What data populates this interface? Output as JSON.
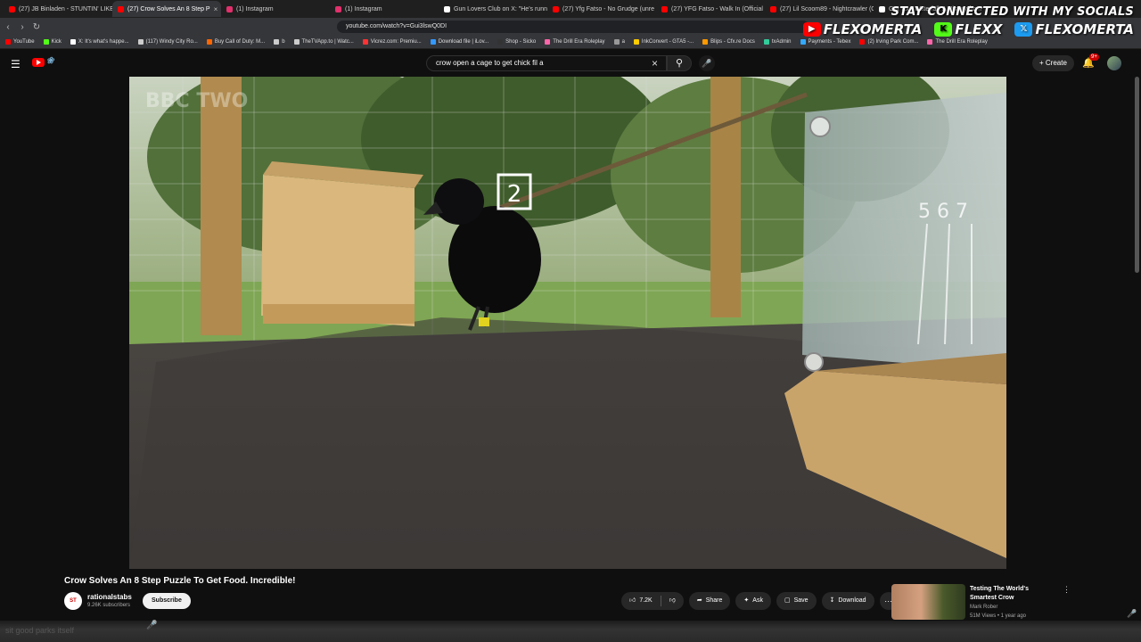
{
  "browser": {
    "tabs": [
      {
        "label": "(27) JB Binladen - STUNTIN' LIKE MY",
        "color": "#ff0000",
        "active": false
      },
      {
        "label": "(27) Crow Solves An 8 Step P",
        "color": "#ff0000",
        "active": true
      },
      {
        "label": "(1) Instagram",
        "color": "#e1306c",
        "active": false
      },
      {
        "label": "(1) Instagram",
        "color": "#e1306c",
        "active": false
      },
      {
        "label": "Gun Lovers Club on X: \"He's running",
        "color": "#ffffff",
        "active": false
      },
      {
        "label": "(27) Yfg Fatso - No Grudge (unre",
        "color": "#ff0000",
        "active": false
      },
      {
        "label": "(27) YFG Fatso - Walk In (Official Mu",
        "color": "#ff0000",
        "active": false
      },
      {
        "label": "(27) Lil Scoom89 - Nightcrawler (Offi",
        "color": "#ff0000",
        "active": false
      },
      {
        "label": "Get Your Waterfall: A History from",
        "color": "#ffffff",
        "active": false
      }
    ],
    "url": "youtube.com/watch?v=Gui3lswQ0DI",
    "bookmarks": [
      {
        "label": "YouTube",
        "color": "#ff0000"
      },
      {
        "label": "Kick",
        "color": "#53fc18"
      },
      {
        "label": "X: It's what's happe...",
        "color": "#ffffff"
      },
      {
        "label": "(117) Windy City Ro...",
        "color": "#cccccc"
      },
      {
        "label": "Buy Call of Duty: M...",
        "color": "#ff6600"
      },
      {
        "label": "b",
        "color": "#cccccc"
      },
      {
        "label": "TheTVApp.to | Watc...",
        "color": "#cccccc"
      },
      {
        "label": "Vicrez.com: Premiu...",
        "color": "#ff3333"
      },
      {
        "label": "Download file | iLov...",
        "color": "#3399ff"
      },
      {
        "label": "Shop - Sicko",
        "color": "#333333"
      },
      {
        "label": "The Drill Era Roleplay",
        "color": "#ff66aa"
      },
      {
        "label": "a",
        "color": "#999999"
      },
      {
        "label": "InkConvert - GTA5 -...",
        "color": "#ffcc00"
      },
      {
        "label": "Blips - Cfx.re Docs",
        "color": "#ff9900"
      },
      {
        "label": "txAdmin",
        "color": "#33cc99"
      },
      {
        "label": "Payments - Tebex",
        "color": "#33aaff"
      },
      {
        "label": "(2) Irving Park Com...",
        "color": "#ff0000"
      },
      {
        "label": "The Drill Era Roleplay",
        "color": "#ff66aa"
      }
    ]
  },
  "overlay": {
    "heading": "STAY CONNECTED WITH MY SOCIALS",
    "youtube": "FLEXOMERTA",
    "kick": "FLEXX",
    "x": "FLEXOMERTA"
  },
  "youtube": {
    "search_value": "crow open a cage to get chick fil a",
    "create_label": "Create",
    "notif_count": "9+"
  },
  "video": {
    "title": "Crow Solves An 8 Step Puzzle To Get Food. Incredible!",
    "watermark": "BBC TWO",
    "sign_number": "2",
    "ruler_numbers": "5 6 7"
  },
  "channel": {
    "name": "rationalstabs",
    "subscribers": "9.26K subscribers",
    "avatar_text": "ST",
    "subscribe_label": "Subscribe"
  },
  "actions": {
    "likes": "7.2K",
    "share": "Share",
    "ask": "Ask",
    "save": "Save",
    "download": "Download"
  },
  "recommended": {
    "title": "Testing The World's Smartest Crow",
    "channel": "Mark Rober",
    "meta": "51M Views • 1 year ago"
  },
  "bottom": {
    "caption": "sit good parks itself"
  }
}
